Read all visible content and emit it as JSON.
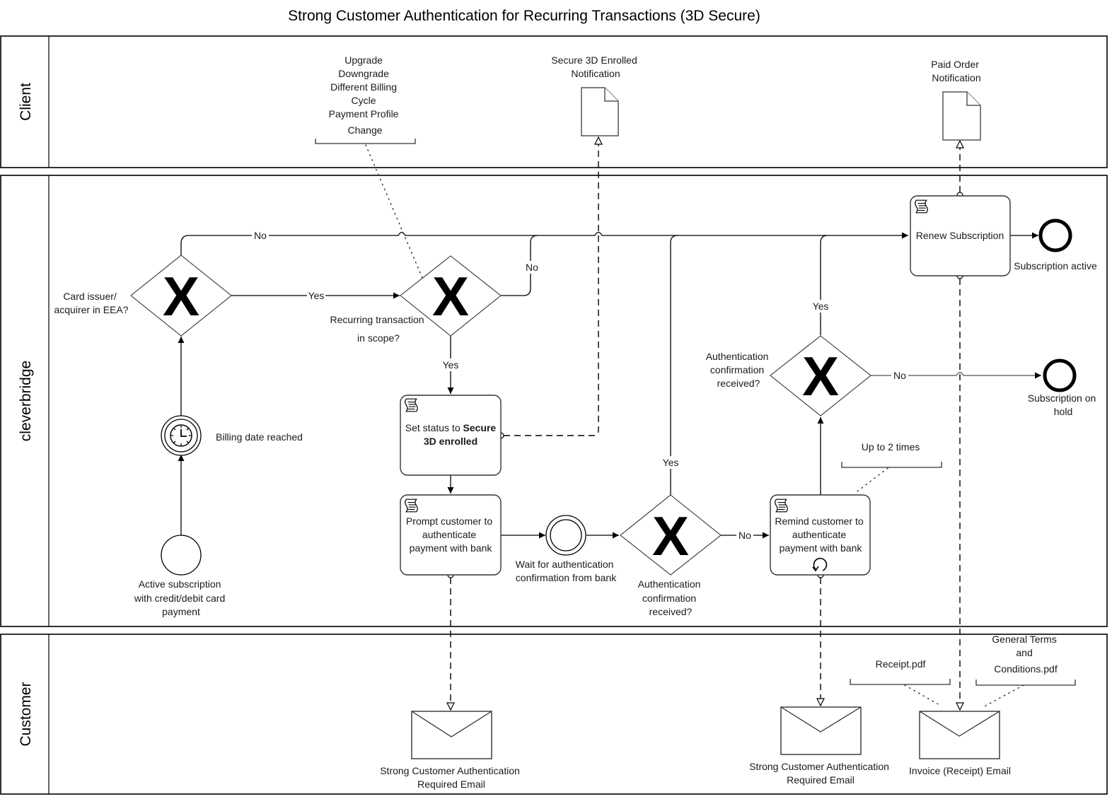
{
  "title": "Strong Customer Authentication for Recurring Transactions (3D Secure)",
  "lanes": {
    "client": "Client",
    "cleverbridge": "cleverbridge",
    "customer": "Customer"
  },
  "client": {
    "annotation_lines": [
      "Upgrade",
      "Downgrade",
      "Different Billing",
      "Cycle",
      "Payment Profile",
      "Change"
    ],
    "secure3d_doc": [
      "Secure 3D Enrolled",
      "Notification"
    ],
    "paid_order_doc": [
      "Paid Order",
      "Notification"
    ]
  },
  "events": {
    "start": [
      "Active subscription",
      "with credit/debit card",
      "payment"
    ],
    "timer": "Billing date reached",
    "wait": [
      "Wait for authentication",
      "confirmation from bank"
    ],
    "end_active": "Subscription active",
    "end_hold": [
      "Subscription on",
      "hold"
    ]
  },
  "gateways": {
    "eea": {
      "symbol": "X",
      "label": [
        "Card issuer/",
        "acquirer in EEA?"
      ]
    },
    "scope": {
      "symbol": "X",
      "label": [
        "Recurring transaction",
        "in scope?"
      ]
    },
    "auth1": {
      "symbol": "X",
      "label": [
        "Authentication",
        "confirmation",
        "received?"
      ]
    },
    "auth2": {
      "symbol": "X",
      "label": [
        "Authentication",
        "confirmation",
        "received?"
      ]
    }
  },
  "tasks": {
    "set_status": {
      "prefix": "Set status to ",
      "bold1": "Secure",
      "bold2": "3D enrolled"
    },
    "prompt": [
      "Prompt customer to",
      "authenticate",
      "payment with bank"
    ],
    "remind": [
      "Remind customer to",
      "authenticate",
      "payment with bank"
    ],
    "renew": "Renew Subscription"
  },
  "flow_labels": {
    "yes": "Yes",
    "no": "No"
  },
  "annotations": {
    "loop": "Up to 2 times",
    "receipt": "Receipt.pdf",
    "gtc": [
      "General Terms",
      "and",
      "Conditions.pdf"
    ]
  },
  "customer": {
    "sca_email_1": [
      "Strong Customer Authentication",
      "Required Email"
    ],
    "sca_email_2": [
      "Strong Customer Authentication",
      "Required Email"
    ],
    "invoice_email": "Invoice (Receipt) Email"
  }
}
